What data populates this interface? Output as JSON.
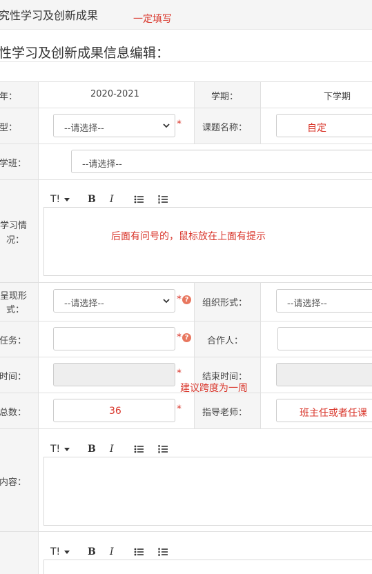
{
  "header": {
    "title": "究性学习及创新成果",
    "note": "一定填写"
  },
  "section": {
    "title": "性学习及创新成果信息编辑："
  },
  "row1": {
    "year_label": "年：",
    "year_value": "2020-2021",
    "term_label": "学期：",
    "term_value": "下学期"
  },
  "row2": {
    "type_label": "型：",
    "type_select": "--请选择--",
    "topic_label": "课题名称：",
    "topic_note": "自定"
  },
  "row3": {
    "class_label": "学班：",
    "class_select": "--请选择--"
  },
  "row4": {
    "label_line1": "学习情",
    "label_line2": "况：",
    "editor_hint": "后面有问号的，鼠标放在上面有提示"
  },
  "row5": {
    "present_label_line1": "呈现形",
    "present_label_line2": "式：",
    "present_select": "--请选择--",
    "org_label": "组织形式：",
    "org_select": "--请选择--"
  },
  "row6": {
    "task_label": "任务：",
    "task_value": "",
    "partner_label": "合作人：",
    "partner_value": ""
  },
  "row7": {
    "start_label": "时间：",
    "end_label": "结束时间：",
    "note": "建议跨度为一周"
  },
  "row8": {
    "total_label": "总数：",
    "total_value": "36",
    "teacher_label": "指导老师：",
    "teacher_value": "班主任或者任课"
  },
  "row9": {
    "content_label": "内容："
  },
  "common": {
    "required_mark": "*",
    "help_mark": "?"
  },
  "toolbar": {
    "font_size": "T!",
    "bold": "B",
    "italic": "I"
  },
  "icons": {
    "help": "question-circle-icon",
    "bullet_list": "bullet-list-icon",
    "ordered_list": "ordered-list-icon",
    "dropdown": "chevron-down-icon"
  },
  "colors": {
    "annotation_red": "#d9362b",
    "help_orange": "#e8775f",
    "label_bg": "#f5f5f5",
    "border": "#e0e0e0"
  }
}
